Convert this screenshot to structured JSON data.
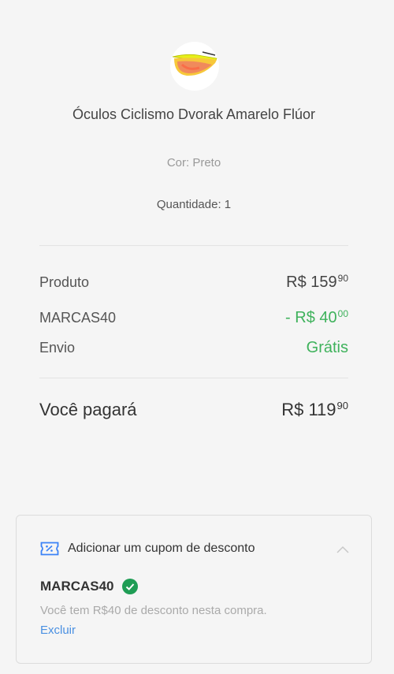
{
  "product": {
    "name": "Óculos Ciclismo Dvorak Amarelo Flúor",
    "color_label": "Cor: Preto",
    "quantity_label": "Quantidade: 1"
  },
  "summary": {
    "product": {
      "label": "Produto",
      "price_main": "R$ 159",
      "price_cents": "90"
    },
    "discount": {
      "label": "MARCAS40",
      "price_main": "- R$ 40",
      "price_cents": "00"
    },
    "shipping": {
      "label": "Envio",
      "value": "Grátis"
    },
    "total": {
      "label": "Você pagará",
      "price_main": "R$ 119",
      "price_cents": "90"
    }
  },
  "coupon": {
    "icon": "ticket-percent-icon",
    "title": "Adicionar um cupom de desconto",
    "code": "MARCAS40",
    "description": "Você tem R$40 de desconto nesta compra.",
    "remove_label": "Excluir"
  },
  "colors": {
    "green": "#3fb25c",
    "link_blue": "#4a90e2",
    "check_green": "#1f9d55",
    "icon_blue": "#3b82f6"
  }
}
